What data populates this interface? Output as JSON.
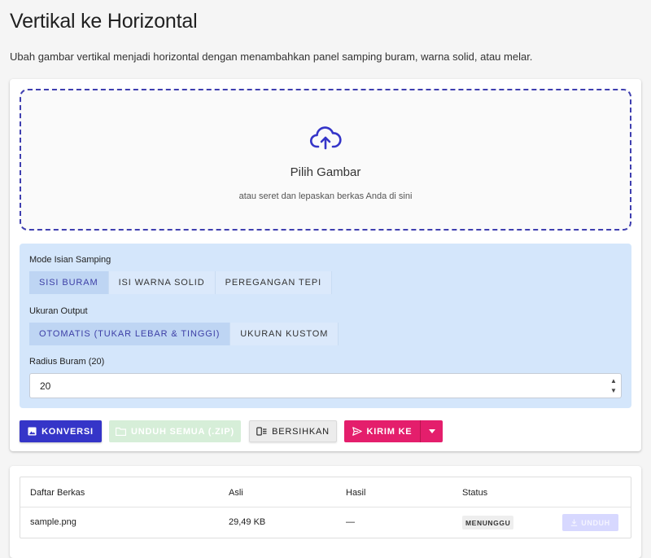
{
  "header": {
    "title": "Vertikal ke Horizontal",
    "description": "Ubah gambar vertikal menjadi horizontal dengan menambahkan panel samping buram, warna solid, atau melar."
  },
  "dropzone": {
    "icon": "cloud-upload-icon",
    "title": "Pilih Gambar",
    "subtitle": "atau seret dan lepaskan berkas Anda di sini"
  },
  "options": {
    "fill_mode_label": "Mode Isian Samping",
    "fill_modes": [
      {
        "label": "SISI BURAM",
        "selected": true
      },
      {
        "label": "ISI WARNA SOLID",
        "selected": false
      },
      {
        "label": "PEREGANGAN TEPI",
        "selected": false
      }
    ],
    "output_size_label": "Ukuran Output",
    "output_sizes": [
      {
        "label": "OTOMATIS (TUKAR LEBAR & TINGGI)",
        "selected": true
      },
      {
        "label": "UKURAN KUSTOM",
        "selected": false
      }
    ],
    "blur_radius_label": "Radius Buram (20)",
    "blur_radius_value": "20"
  },
  "actions": {
    "convert": "KONVERSI",
    "download_all": "UNDUH SEMUA (.ZIP)",
    "clear": "BERSIHKAN",
    "send_to": "KIRIM KE"
  },
  "file_table": {
    "columns": [
      "Daftar Berkas",
      "Asli",
      "Hasil",
      "Status"
    ],
    "rows": [
      {
        "name": "sample.png",
        "original": "29,49 KB",
        "result": "—",
        "status": "MENUNGGU",
        "action": "UNDUH"
      }
    ]
  },
  "colors": {
    "primary": "#3535c8",
    "accent": "#e41e6c",
    "options_bg": "#d4e6fb",
    "success_disabled": "#d6eed8"
  }
}
